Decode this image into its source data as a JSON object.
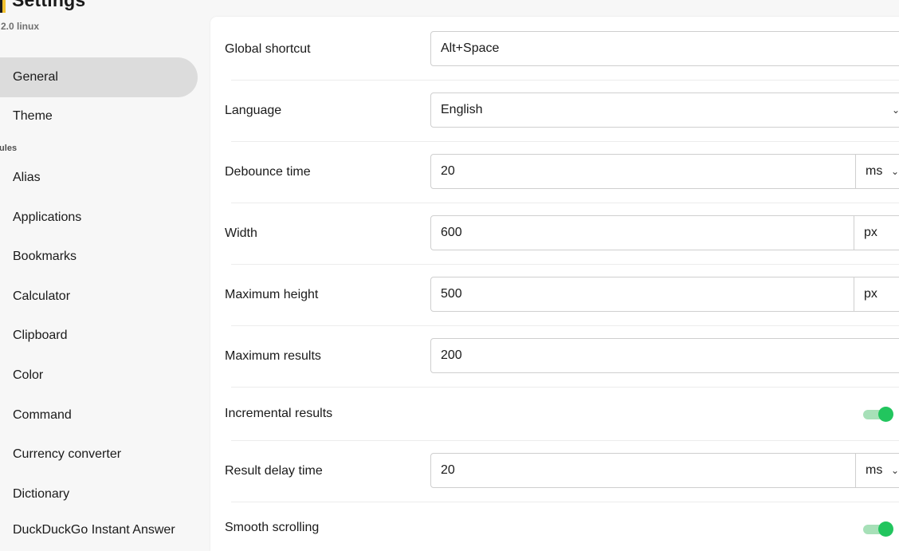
{
  "app": {
    "title": "Settings",
    "version": "2.0 linux"
  },
  "sidebar": {
    "items": [
      {
        "label": "General",
        "active": true
      },
      {
        "label": "Theme"
      }
    ],
    "section_label": "lules",
    "modules": [
      {
        "label": "Alias"
      },
      {
        "label": "Applications"
      },
      {
        "label": "Bookmarks"
      },
      {
        "label": "Calculator"
      },
      {
        "label": "Clipboard"
      },
      {
        "label": "Color"
      },
      {
        "label": "Command"
      },
      {
        "label": "Currency converter"
      },
      {
        "label": "Dictionary"
      },
      {
        "label": "DuckDuckGo Instant Answer"
      }
    ]
  },
  "settings": {
    "global_shortcut": {
      "label": "Global shortcut",
      "value": "Alt+Space"
    },
    "language": {
      "label": "Language",
      "value": "English"
    },
    "debounce_time": {
      "label": "Debounce time",
      "value": "20",
      "unit": "ms"
    },
    "width": {
      "label": "Width",
      "value": "600",
      "unit": "px"
    },
    "maximum_height": {
      "label": "Maximum height",
      "value": "500",
      "unit": "px"
    },
    "maximum_results": {
      "label": "Maximum results",
      "value": "200"
    },
    "incremental_results": {
      "label": "Incremental results",
      "enabled": true
    },
    "result_delay_time": {
      "label": "Result delay time",
      "value": "20",
      "unit": "ms"
    },
    "smooth_scrolling": {
      "label": "Smooth scrolling",
      "enabled": true
    }
  },
  "colors": {
    "accent": "#22c55e",
    "accent_track": "#a7e0b8",
    "active_nav": "#dcdcdc"
  }
}
